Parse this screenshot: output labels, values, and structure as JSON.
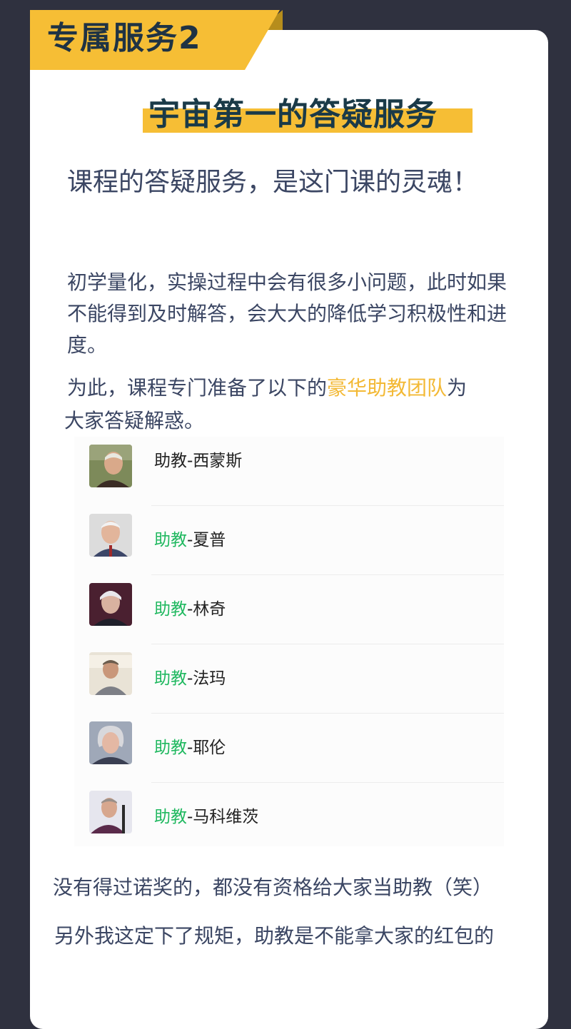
{
  "header": {
    "ribbon_label": "专属服务2",
    "headline": "宇宙第一的答疑服务"
  },
  "intro": {
    "subtitle": "课程的答疑服务，是这门课的灵魂！",
    "paragraph1": "初学量化，实操过程中会有很多小问题，此时如果不能得到及时解答，会大大的降低学习积极性和进度。",
    "paragraph2_before": "为此，课程专门准备了以下的",
    "paragraph2_highlight": "豪华助教团队",
    "paragraph2_after": "为",
    "paragraph3": "大家答疑解惑。"
  },
  "team": [
    {
      "prefix": "助教",
      "suffix": "-西蒙斯",
      "prefix_green": false,
      "avatar": "portrait-simons"
    },
    {
      "prefix": "助教",
      "suffix": "-夏普",
      "prefix_green": true,
      "avatar": "portrait-sharpe"
    },
    {
      "prefix": "助教",
      "suffix": "-林奇",
      "prefix_green": true,
      "avatar": "portrait-lynch"
    },
    {
      "prefix": "助教",
      "suffix": "-法玛",
      "prefix_green": true,
      "avatar": "portrait-fama"
    },
    {
      "prefix": "助教",
      "suffix": "-耶伦",
      "prefix_green": true,
      "avatar": "portrait-yellen"
    },
    {
      "prefix": "助教",
      "suffix": "-马科维茨",
      "prefix_green": true,
      "avatar": "portrait-markowitz"
    }
  ],
  "footer": {
    "line1": "没有得过诺奖的，都没有资格给大家当助教（笑）",
    "line2": "另外我这定下了规矩，助教是不能拿大家的红包的"
  },
  "colors": {
    "background": "#2f313f",
    "accent_yellow": "#f6be35",
    "highlight_text": "#f3b935",
    "green_prefix": "#1fb85f",
    "body_text": "#3b4663"
  }
}
